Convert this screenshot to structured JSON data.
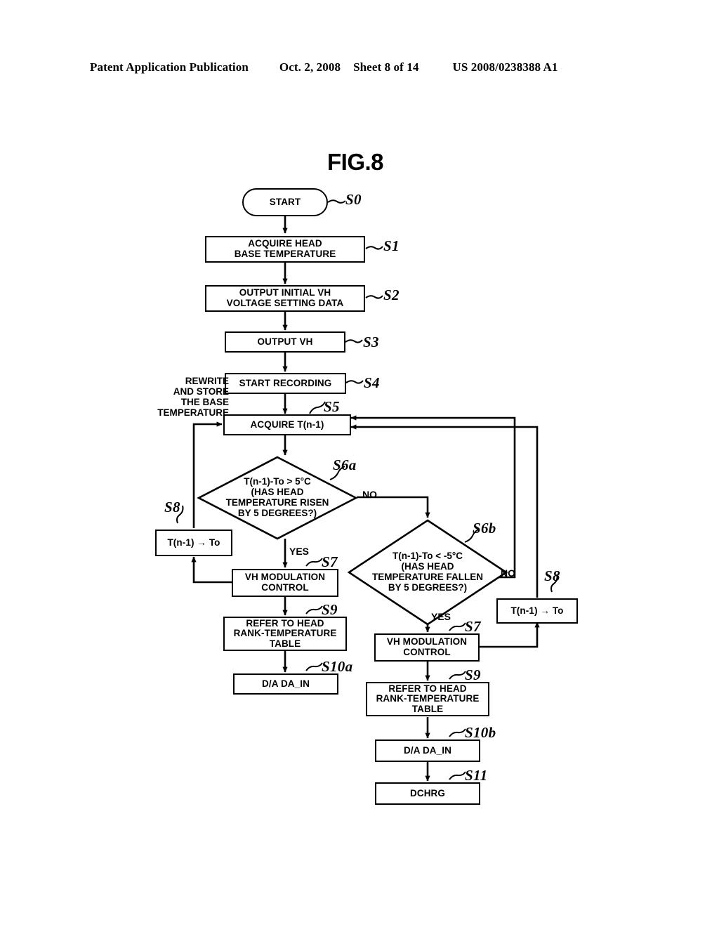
{
  "header": {
    "publication": "Patent Application Publication",
    "date": "Oct. 2, 2008",
    "sheet": "Sheet 8 of 14",
    "patent_number": "US 2008/0238388 A1"
  },
  "figure": {
    "title": "FIG.8"
  },
  "annotation": {
    "rewrite_store": [
      "REWRITE",
      "AND STORE",
      "THE BASE",
      "TEMPERATURE"
    ]
  },
  "nodes": {
    "start": {
      "label": [
        "START"
      ],
      "step": "S0"
    },
    "s1": {
      "label": [
        "ACQUIRE HEAD",
        "BASE TEMPERATURE"
      ],
      "step": "S1"
    },
    "s2": {
      "label": [
        "OUTPUT INITIAL VH",
        "VOLTAGE SETTING DATA"
      ],
      "step": "S2"
    },
    "s3": {
      "label": [
        "OUTPUT VH"
      ],
      "step": "S3"
    },
    "s4": {
      "label": [
        "START RECORDING"
      ],
      "step": "S4"
    },
    "s5": {
      "label": [
        "ACQUIRE T(n-1)"
      ],
      "step": "S5"
    },
    "s6a": {
      "label": [
        "T(n-1)-To > 5°C",
        "(HAS HEAD",
        "TEMPERATURE RISEN",
        "BY 5 DEGREES?)"
      ],
      "step": "S6a",
      "yes": "YES",
      "no": "NO"
    },
    "s6b": {
      "label": [
        "T(n-1)-To < -5°C",
        "(HAS HEAD",
        "TEMPERATURE FALLEN",
        "BY 5 DEGREES?)"
      ],
      "step": "S6b",
      "yes": "YES",
      "no": "NO"
    },
    "s8_left": {
      "label": [
        "T(n-1) → To"
      ],
      "step": "S8"
    },
    "s8_right": {
      "label": [
        "T(n-1) → To"
      ],
      "step": "S8"
    },
    "s7_left": {
      "label": [
        "VH MODULATION",
        "CONTROL"
      ],
      "step": "S7"
    },
    "s7_right": {
      "label": [
        "VH MODULATION",
        "CONTROL"
      ],
      "step": "S7"
    },
    "s9_left": {
      "label": [
        "REFER TO HEAD",
        "RANK-TEMPERATURE",
        "TABLE"
      ],
      "step": "S9"
    },
    "s9_right": {
      "label": [
        "REFER TO HEAD",
        "RANK-TEMPERATURE",
        "TABLE"
      ],
      "step": "S9"
    },
    "s10a": {
      "label": [
        "D/A DA_IN"
      ],
      "step": "S10a"
    },
    "s10b": {
      "label": [
        "D/A DA_IN"
      ],
      "step": "S10b"
    },
    "s11": {
      "label": [
        "DCHRG"
      ],
      "step": "S11"
    }
  },
  "colors": {
    "ink": "#000000",
    "paper": "#ffffff"
  }
}
